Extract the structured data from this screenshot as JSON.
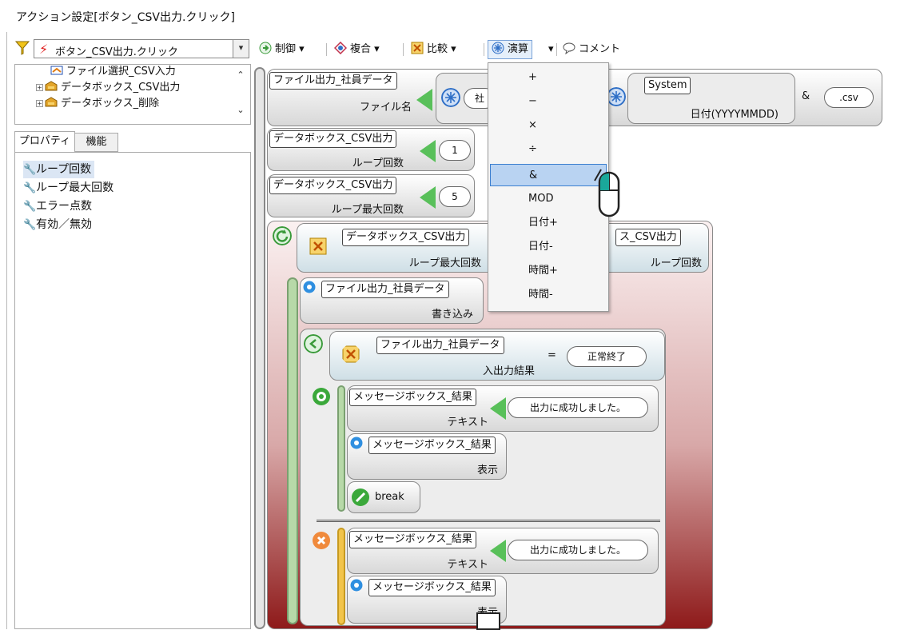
{
  "window": {
    "title": "アクション設定[ボタン_CSV出力.クリック]"
  },
  "event_selector": {
    "value": "ボタン_CSV出力.クリック",
    "dropdown_icon": "chevron-down-icon"
  },
  "tree": {
    "items": [
      {
        "label": "ファイル選択_CSV入力",
        "icon": "file-select-icon"
      },
      {
        "label": "データボックス_CSV出力",
        "icon": "databox-icon"
      },
      {
        "label": "データボックス_削除",
        "icon": "databox-icon"
      }
    ]
  },
  "tabs": {
    "properties": "プロパティ",
    "functions": "機能"
  },
  "properties": [
    {
      "label": "ループ回数",
      "selected": true
    },
    {
      "label": "ループ最大回数",
      "selected": false
    },
    {
      "label": "エラー点数",
      "selected": false
    },
    {
      "label": "有効／無効",
      "selected": false
    }
  ],
  "toolbar": {
    "control": "制御",
    "compound": "複合",
    "compare": "比較",
    "calc": "演算",
    "comment": "コメント"
  },
  "calc_menu": {
    "items": [
      "+",
      "−",
      "×",
      "÷",
      "&",
      "MOD",
      "日付+",
      "日付-",
      "時間+",
      "時間-"
    ],
    "highlighted": "&"
  },
  "canvas": {
    "row1": {
      "target": "ファイル出力_社員データ",
      "prop": "ファイル名",
      "partial_pill": "社",
      "system_label": "System",
      "system_prop": "日付(YYYYMMDD)",
      "amp": "&",
      "csv": ".csv"
    },
    "row2": {
      "target": "データボックス_CSV出力",
      "prop": "ループ回数",
      "value": "1"
    },
    "row3": {
      "target": "データボックス_CSV出力",
      "prop": "ループ最大回数",
      "value": "5"
    },
    "loop": {
      "left_target": "データボックス_CSV出力",
      "left_prop": "ループ最大回数",
      "right_target": "ス_CSV出力",
      "right_prop": "ループ回数"
    },
    "write": {
      "target": "ファイル出力_社員データ",
      "method": "書き込み"
    },
    "cond": {
      "target": "ファイル出力_社員データ",
      "prop": "入出力結果",
      "op": "=",
      "value": "正常終了"
    },
    "ok_branch": {
      "msg_target": "メッセージボックス_結果",
      "msg_prop": "テキスト",
      "msg_value": "出力に成功しました。",
      "show_target": "メッセージボックス_結果",
      "show_method": "表示",
      "break_label": "break"
    },
    "ng_branch": {
      "msg_target": "メッセージボックス_結果",
      "msg_prop": "テキスト",
      "msg_value": "出力に成功しました。",
      "show_target": "メッセージボックス_結果",
      "show_method": "表示"
    }
  },
  "colors": {
    "accent_blue": "#2f6fc6",
    "green": "#59c05a",
    "loop_dark_red": "#8e1a1a",
    "orange": "#f08a3c"
  }
}
